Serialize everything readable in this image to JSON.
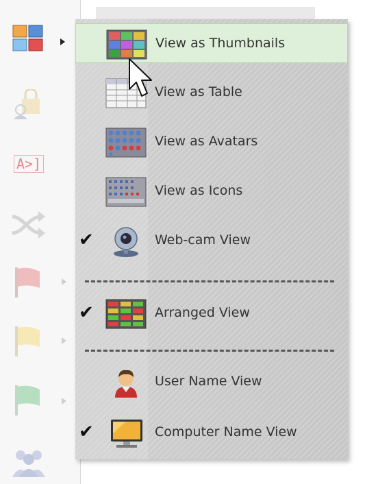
{
  "menu": {
    "items": [
      {
        "label": "View as Thumbnails",
        "icon": "thumbnails-icon",
        "checked": false,
        "highlighted": true
      },
      {
        "label": "View as Table",
        "icon": "table-icon",
        "checked": false,
        "highlighted": false
      },
      {
        "label": "View as Avatars",
        "icon": "avatars-icon",
        "checked": false,
        "highlighted": false
      },
      {
        "label": "View as Icons",
        "icon": "icons-view-icon",
        "checked": false,
        "highlighted": false
      },
      {
        "label": "Web-cam View",
        "icon": "webcam-icon",
        "checked": true,
        "highlighted": false
      },
      {
        "label": "Arranged View",
        "icon": "arranged-grid-icon",
        "checked": true,
        "highlighted": false
      },
      {
        "label": "User Name View",
        "icon": "user-icon",
        "checked": false,
        "highlighted": false
      },
      {
        "label": "Computer Name View",
        "icon": "computer-icon",
        "checked": true,
        "highlighted": false
      }
    ],
    "check_glyph": "✔"
  },
  "toolbar": {
    "buttons": [
      {
        "icon": "view-mode-icon",
        "has_submenu": true
      },
      {
        "icon": "lock-user-icon",
        "has_submenu": false
      },
      {
        "icon": "text-input-icon",
        "has_submenu": false,
        "text": "A>]"
      },
      {
        "icon": "shuffle-icon",
        "has_submenu": false
      },
      {
        "icon": "red-flag-icon",
        "has_submenu": true
      },
      {
        "icon": "yellow-flag-icon",
        "has_submenu": true
      },
      {
        "icon": "green-flag-icon",
        "has_submenu": true
      },
      {
        "icon": "users-group-icon",
        "has_submenu": false
      }
    ]
  },
  "colors": {
    "highlight": "#dff0da",
    "menu_bg": "#c9c9c9",
    "text": "#333333"
  }
}
